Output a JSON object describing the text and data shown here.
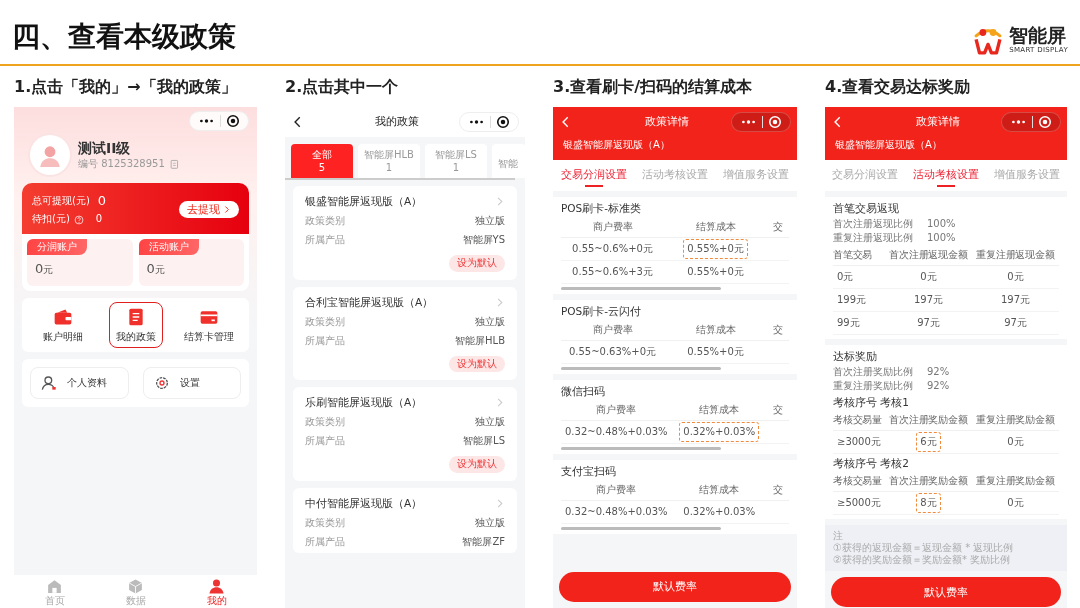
{
  "slide": {
    "title": "四、查看本级政策",
    "logo": {
      "name": "智能屏",
      "tagline": "SMART DISPLAY"
    }
  },
  "steps": [
    {
      "label": "1.点击「我的」→「我的政策」",
      "kind": "profile",
      "screen": {
        "user_name": "测试II级",
        "user_id": "编号 8125328951",
        "balance_label": "总可提现(元)",
        "balance": "0",
        "pending_label": "待扣(元)",
        "pending": "0",
        "withdraw_button": "去提现",
        "accounts": [
          {
            "label": "分润账户",
            "amount": "0",
            "unit": "元"
          },
          {
            "label": "活动账户",
            "amount": "0",
            "unit": "元"
          }
        ],
        "shortcuts": [
          {
            "label": "账户明细",
            "kind": "wallet",
            "highlighted": false
          },
          {
            "label": "我的政策",
            "kind": "document",
            "highlighted": true
          },
          {
            "label": "结算卡管理",
            "kind": "card",
            "highlighted": false
          }
        ],
        "links": [
          {
            "label": "个人资料",
            "kind": "person"
          },
          {
            "label": "设置",
            "kind": "gear"
          }
        ],
        "tabbar": [
          {
            "label": "首页",
            "kind": "home",
            "selected": false
          },
          {
            "label": "数据",
            "kind": "cube",
            "selected": false
          },
          {
            "label": "我的",
            "kind": "person",
            "selected": true
          }
        ]
      }
    },
    {
      "label": "2.点击其中一个",
      "kind": "policy_list",
      "screen": {
        "title": "我的政策",
        "tabs": [
          {
            "label": "全部",
            "count": "5",
            "selected": true
          },
          {
            "label": "智能屏HLB",
            "count": "1",
            "selected": false
          },
          {
            "label": "智能屏LS",
            "count": "1",
            "selected": false
          },
          {
            "label": "智能",
            "selected": false
          }
        ],
        "policies": [
          {
            "name": "银盛智能屏返现版（A）",
            "fields": [
              {
                "label": "政策类别",
                "value": "独立版"
              },
              {
                "label": "所属产品",
                "value": "智能屏YS"
              }
            ],
            "action": "设为默认"
          },
          {
            "name": "合利宝智能屏返现版（A）",
            "fields": [
              {
                "label": "政策类别",
                "value": "独立版"
              },
              {
                "label": "所属产品",
                "value": "智能屏HLB"
              }
            ],
            "action": "设为默认"
          },
          {
            "name": "乐刷智能屏返现版（A）",
            "fields": [
              {
                "label": "政策类别",
                "value": "独立版"
              },
              {
                "label": "所属产品",
                "value": "智能屏LS"
              }
            ],
            "action": "设为默认"
          },
          {
            "name": "中付智能屏返现版（A）",
            "fields": [
              {
                "label": "政策类别",
                "value": "独立版"
              },
              {
                "label": "所属产品",
                "value": "智能屏ZF"
              }
            ]
          }
        ]
      }
    },
    {
      "label": "3.查看刷卡/扫码的结算成本",
      "kind": "rate_detail",
      "screen": {
        "title": "政策详情",
        "subtitle": "银盛智能屏返现版（A）",
        "tabs": [
          {
            "label": "交易分润设置",
            "selected": true
          },
          {
            "label": "活动考核设置",
            "selected": false
          },
          {
            "label": "增值服务设置",
            "selected": false
          }
        ],
        "sections": [
          {
            "title": "POS刷卡-标准类",
            "columns": [
              "商户费率",
              "结算成本",
              "交"
            ],
            "rows": [
              [
                {
                  "text": "0.55~0.6%+0元",
                  "highlighted": false
                },
                {
                  "text": "0.55%+0元",
                  "highlighted": true
                }
              ],
              [
                {
                  "text": "0.55~0.6%+3元",
                  "highlighted": false
                },
                {
                  "text": "0.55%+0元",
                  "highlighted": false
                }
              ]
            ]
          },
          {
            "title": "POS刷卡-云闪付",
            "columns": [
              "商户费率",
              "结算成本",
              "交"
            ],
            "rows": [
              [
                {
                  "text": "0.55~0.63%+0元",
                  "highlighted": false
                },
                {
                  "text": "0.55%+0元",
                  "highlighted": false
                }
              ]
            ]
          },
          {
            "title": "微信扫码",
            "columns": [
              "商户费率",
              "结算成本",
              "交"
            ],
            "rows": [
              [
                {
                  "text": "0.32~0.48%+0.03%",
                  "highlighted": false
                },
                {
                  "text": "0.32%+0.03%",
                  "highlighted": true
                }
              ]
            ]
          },
          {
            "title": "支付宝扫码",
            "columns": [
              "商户费率",
              "结算成本",
              "交"
            ],
            "rows": [
              [
                {
                  "text": "0.32~0.48%+0.03%",
                  "highlighted": false
                },
                {
                  "text": "0.32%+0.03%",
                  "highlighted": false
                }
              ]
            ]
          }
        ],
        "button": "默认费率"
      }
    },
    {
      "label": "4.查看交易达标奖励",
      "kind": "reward_detail",
      "screen": {
        "title": "政策详情",
        "subtitle": "银盛智能屏返现版（A）",
        "tabs": [
          {
            "label": "交易分润设置",
            "selected": false
          },
          {
            "label": "活动考核设置",
            "selected": true
          },
          {
            "label": "增值服务设置",
            "selected": false
          }
        ],
        "cashback": {
          "title": "首笔交易返现",
          "ratios": [
            {
              "label": "首次注册返现比例",
              "value": "100%"
            },
            {
              "label": "重复注册返现比例",
              "value": "100%"
            }
          ],
          "columns": [
            "首笔交易",
            "首次注册返现金额",
            "重复注册返现金额"
          ],
          "rows": [
            [
              {
                "text": "0元",
                "highlighted": false
              },
              {
                "text": "0元",
                "highlighted": false
              },
              {
                "text": "0元",
                "highlighted": false
              }
            ],
            [
              {
                "text": "199元",
                "highlighted": false
              },
              {
                "text": "197元",
                "highlighted": false
              },
              {
                "text": "197元",
                "highlighted": false
              }
            ],
            [
              {
                "text": "99元",
                "highlighted": false
              },
              {
                "text": "97元",
                "highlighted": false
              },
              {
                "text": "97元",
                "highlighted": false
              }
            ]
          ]
        },
        "reward": {
          "title": "达标奖励",
          "ratios": [
            {
              "label": "首次注册奖励比例",
              "value": "92%"
            },
            {
              "label": "重复注册奖励比例",
              "value": "92%"
            }
          ],
          "assessments": [
            {
              "title": "考核序号 考核1",
              "columns": [
                "考核交易量",
                "首次注册奖励金额",
                "重复注册奖励金额"
              ],
              "rows": [
                [
                  {
                    "text": "≥3000元",
                    "highlighted": false
                  },
                  {
                    "text": "6元",
                    "highlighted": true
                  },
                  {
                    "text": "0元",
                    "highlighted": false
                  }
                ]
              ]
            },
            {
              "title": "考核序号 考核2",
              "columns": [
                "考核交易量",
                "首次注册奖励金额",
                "重复注册奖励金额"
              ],
              "rows": [
                [
                  {
                    "text": "≥5000元",
                    "highlighted": false
                  },
                  {
                    "text": "8元",
                    "highlighted": true
                  },
                  {
                    "text": "0元",
                    "highlighted": false
                  }
                ]
              ]
            }
          ]
        },
        "notes": [
          "注",
          "①获得的返现金额＝返现金额 * 返现比例",
          "②获得的奖励金额＝奖励金额* 奖励比例"
        ],
        "button": "默认费率"
      }
    }
  ]
}
